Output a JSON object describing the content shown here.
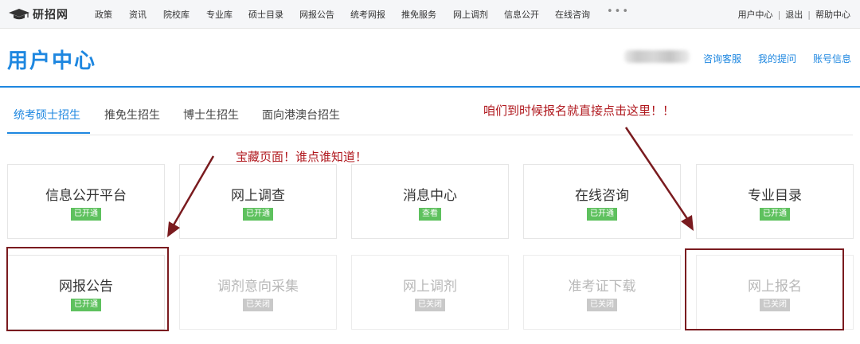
{
  "topnav": {
    "logo_text": "研招网",
    "items": [
      "政策",
      "资讯",
      "院校库",
      "专业库",
      "硕士目录",
      "网报公告",
      "统考网报",
      "推免服务",
      "网上调剂",
      "信息公开",
      "在线咨询"
    ],
    "more": "•••",
    "user_links": [
      "用户中心",
      "退出",
      "帮助中心"
    ],
    "separator": "|"
  },
  "header": {
    "title": "用户中心",
    "links": [
      "咨询客服",
      "我的提问",
      "账号信息"
    ]
  },
  "tabs": [
    "统考硕士招生",
    "推免生招生",
    "博士生招生",
    "面向港澳台招生"
  ],
  "cards": [
    {
      "title": "信息公开平台",
      "badge": "已开通",
      "state": "on"
    },
    {
      "title": "网上调查",
      "badge": "已开通",
      "state": "on"
    },
    {
      "title": "消息中心",
      "badge": "查看",
      "state": "on"
    },
    {
      "title": "在线咨询",
      "badge": "已开通",
      "state": "on"
    },
    {
      "title": "专业目录",
      "badge": "已开通",
      "state": "on"
    },
    {
      "title": "网报公告",
      "badge": "已开通",
      "state": "on"
    },
    {
      "title": "调剂意向采集",
      "badge": "已关闭",
      "state": "off"
    },
    {
      "title": "网上调剂",
      "badge": "已关闭",
      "state": "off"
    },
    {
      "title": "准考证下载",
      "badge": "已关闭",
      "state": "off"
    },
    {
      "title": "网上报名",
      "badge": "已关闭",
      "state": "off"
    }
  ],
  "annotations": {
    "left": "宝藏页面！谁点谁知道！",
    "right": "咱们到时候报名就直接点击这里！！"
  },
  "colors": {
    "accent": "#1e87e0",
    "badge_on": "#5ec15e",
    "badge_off": "#c9c9c9",
    "annotation_text": "#b0181e",
    "annotation_box": "#7a1b1f"
  }
}
